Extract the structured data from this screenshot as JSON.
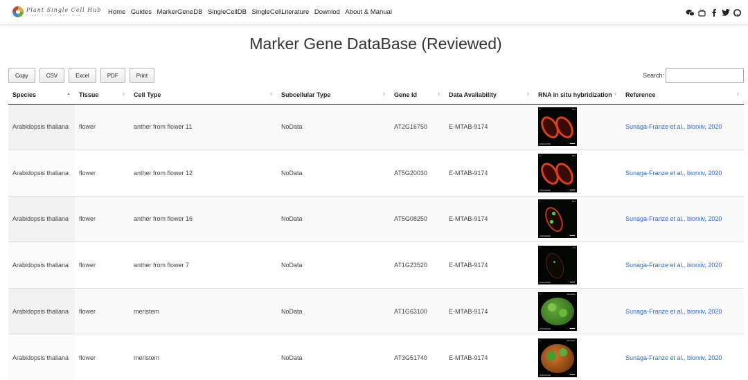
{
  "nav": {
    "brand_title": "Plant Single Cell Hub",
    "brand_sub": "Plant Single Cell Hub",
    "links": [
      "Home",
      "Guides",
      "MarkerGeneDB",
      "SingleCellDB",
      "SingleCellLiterature",
      "Downlod",
      "About & Manual"
    ],
    "icons": [
      "wechat-icon",
      "bilibili-icon",
      "facebook-icon",
      "twitter-icon",
      "github-icon"
    ]
  },
  "title": "Marker Gene DataBase (Reviewed)",
  "toolbar": {
    "buttons": [
      "Copy",
      "CSV",
      "Excel",
      "PDF",
      "Print"
    ],
    "search_label": "Search:",
    "search_value": ""
  },
  "table": {
    "columns": [
      "Species",
      "Tissue",
      "Cell Type",
      "Subcellular Type",
      "Gene Id",
      "Data Availability",
      "RNA in situ hybridization",
      "Reference"
    ],
    "sorted_column": "Species",
    "rows": [
      {
        "species": "Arabidopsis thaliana",
        "tissue": "flower",
        "cell_type": "anther from flower 11",
        "subcellular": "NoData",
        "gene_id": "AT2G16750",
        "data": "E-MTAB-9174",
        "ish_panel": "b",
        "ish_stage": "F11",
        "ish_gene": "AT2G16750",
        "ish_style": "anther-red",
        "reference": "Sunaga-Franze et al., biorxiv, 2020"
      },
      {
        "species": "Arabidopsis thaliana",
        "tissue": "flower",
        "cell_type": "anther from flower 12",
        "subcellular": "NoData",
        "gene_id": "AT5G20030",
        "data": "E-MTAB-9174",
        "ish_panel": "g",
        "ish_stage": "F12",
        "ish_gene": "AT5G20030",
        "ish_style": "anther-red",
        "reference": "Sunaga-Franze et al., biorxiv, 2020"
      },
      {
        "species": "Arabidopsis thaliana",
        "tissue": "flower",
        "cell_type": "anther from flower 16",
        "subcellular": "NoData",
        "gene_id": "AT5G08250",
        "data": "E-MTAB-9174",
        "ish_panel": "f",
        "ish_stage": "F16",
        "ish_gene": "AT5G08250",
        "ish_style": "anther-green",
        "reference": "Sunaga-Franze et al., biorxiv, 2020"
      },
      {
        "species": "Arabidopsis thaliana",
        "tissue": "flower",
        "cell_type": "anther from flower 7",
        "subcellular": "NoData",
        "gene_id": "AT1G23520",
        "data": "E-MTAB-9174",
        "ish_panel": "c",
        "ish_stage": "F7",
        "ish_gene": "AT1G23520",
        "ish_style": "anther-dark",
        "reference": "Sunaga-Franze et al., biorxiv, 2020"
      },
      {
        "species": "Arabidopsis thaliana",
        "tissue": "flower",
        "cell_type": "meristem",
        "subcellular": "NoData",
        "gene_id": "AT1G63100",
        "data": "E-MTAB-9174",
        "ish_panel": "b",
        "ish_stage": "Meristem",
        "ish_gene": "AT1G63100",
        "ish_style": "meristem-green",
        "reference": "Sunaga-Franze et al., biorxiv, 2020"
      },
      {
        "species": "Arabidopsis thaliana",
        "tissue": "flower",
        "cell_type": "meristem",
        "subcellular": "NoData",
        "gene_id": "AT3G51740",
        "data": "E-MTAB-9174",
        "ish_panel": "e",
        "ish_stage": "Meristem",
        "ish_gene": "AT3G51740",
        "ish_style": "meristem-orange",
        "reference": "Sunaga-Franze et al., biorxiv, 2020"
      }
    ]
  },
  "colors": {
    "link": "#2a6ad6",
    "sort_active": "#8e8ecf",
    "row_stripe": "#f9f9f9"
  }
}
